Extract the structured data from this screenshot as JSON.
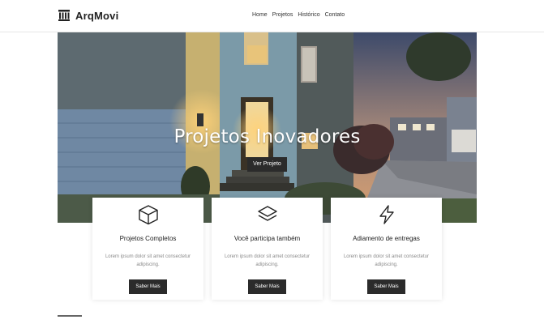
{
  "brand": {
    "name": "ArqMovi",
    "icon": "building-columns-icon"
  },
  "nav": {
    "items": [
      "Home",
      "Projetos",
      "Histórico",
      "Contato"
    ]
  },
  "hero": {
    "title": "Projetos Inovadores",
    "button": "Ver Projeto"
  },
  "cards": [
    {
      "icon": "cube-icon",
      "title": "Projetos Completos",
      "text": "Lorem ipsum dolor sit amet consectetur adipiscing.",
      "button": "Saber Mais"
    },
    {
      "icon": "layers-icon",
      "title": "Você participa também",
      "text": "Lorem ipsum dolor sit amet consectetur adipiscing.",
      "button": "Saber Mais"
    },
    {
      "icon": "lightning-icon",
      "title": "Adiamento de entregas",
      "text": "Lorem ipsum dolor sit amet consectetur adipiscing.",
      "button": "Saber Mais"
    }
  ],
  "colors": {
    "accent": "#2b2b2b",
    "text": "#222222",
    "muted": "#8a8a8a"
  }
}
